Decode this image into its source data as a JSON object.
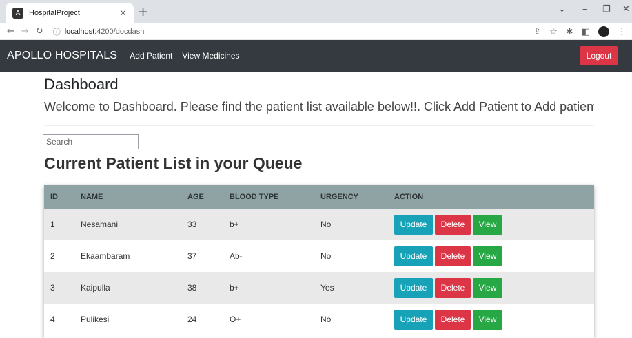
{
  "browser": {
    "tab_title": "HospitalProject",
    "tab_close": "×",
    "new_tab": "+",
    "url_host": "localhost",
    "url_path": ":4200/docdash"
  },
  "navbar": {
    "brand": "APOLLO HOSPITALS",
    "links": [
      "Add Patient",
      "View Medicines"
    ],
    "logout_label": "Logout"
  },
  "main": {
    "title": "Dashboard",
    "welcome": "Welcome to Dashboard. Please find the patient list available below!!. Click Add Patient to Add patients, Click View Medicines to view medicines",
    "search_placeholder": "Search",
    "list_title": "Current Patient List in your Queue"
  },
  "table": {
    "headers": [
      "ID",
      "NAME",
      "AGE",
      "BLOOD TYPE",
      "URGENCY",
      "ACTION"
    ],
    "rows": [
      {
        "id": "1",
        "name": "Nesamani",
        "age": "33",
        "blood": "b+",
        "urgency": "No"
      },
      {
        "id": "2",
        "name": "Ekaambaram",
        "age": "37",
        "blood": "Ab-",
        "urgency": "No"
      },
      {
        "id": "3",
        "name": "Kaipulla",
        "age": "38",
        "blood": "b+",
        "urgency": "Yes"
      },
      {
        "id": "4",
        "name": "Pulikesi",
        "age": "24",
        "blood": "O+",
        "urgency": "No"
      }
    ],
    "actions": {
      "update": "Update",
      "delete": "Delete",
      "view": "View"
    }
  },
  "colors": {
    "navbar_bg": "#343a40",
    "update": "#17a2b8",
    "delete": "#dc3545",
    "view": "#28a745",
    "table_header": "#8fa3a4"
  }
}
